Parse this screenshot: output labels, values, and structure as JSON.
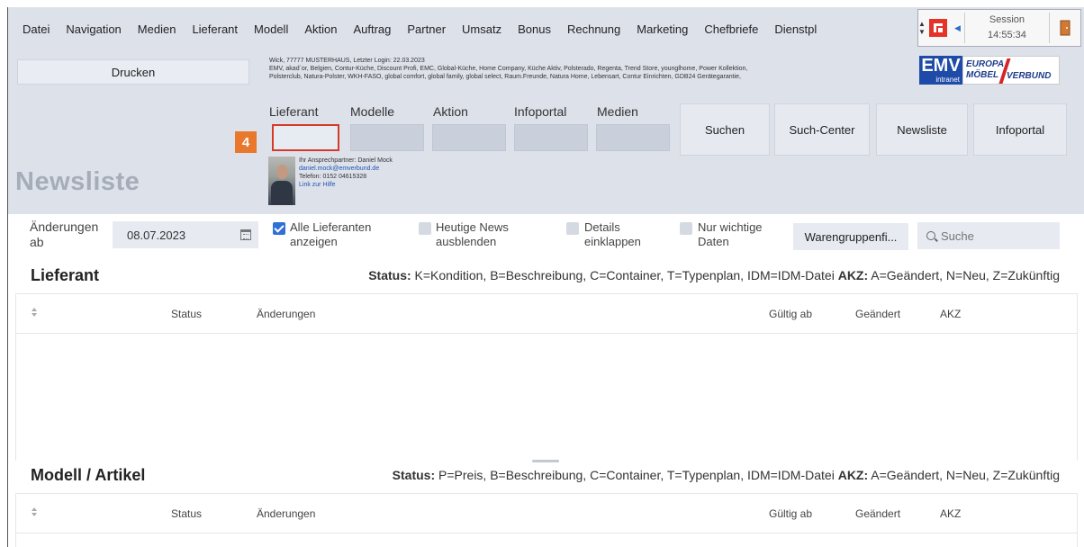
{
  "menu": [
    "Datei",
    "Navigation",
    "Medien",
    "Lieferant",
    "Modell",
    "Aktion",
    "Auftrag",
    "Partner",
    "Umsatz",
    "Bonus",
    "Rechnung",
    "Marketing",
    "Chefbriefe",
    "Dienstpl"
  ],
  "session": {
    "label": "Session",
    "time": "14:55:34"
  },
  "print_label": "Drucken",
  "info": {
    "line1": "Wick, 77777 MUSTERHAUS, Letzter Login: 22.03.2023",
    "line2": "EMV, akad`or, Belgien, Contur-Küche, Discount Profi, EMC, Global-Küche, Home Company, Küche Aktiv, Polsterado, Regenta, Trend Store, younglhome, Power Kollektion,",
    "line3": "Polsterclub, Natura-Polster, WKH-FASO, global comfort, global family, global select, Raum.Freunde, Natura Home, Lebensart, Contur Einrichten, GDB24 Gerätegarantie,"
  },
  "logos": {
    "emv": "EMV",
    "emv_sub": "intranet",
    "europa_1": "EUROPA",
    "europa_2": "MÖBEL",
    "europa_3": "VERBUND"
  },
  "filters": {
    "lieferant": "Lieferant",
    "modelle": "Modelle",
    "aktion": "Aktion",
    "infoportal": "Infoportal",
    "medien": "Medien"
  },
  "step_badge": "4",
  "buttons": {
    "suchen": "Suchen",
    "such_center": "Such-Center",
    "newsliste": "Newsliste",
    "infoportal": "Infoportal"
  },
  "contact": {
    "partner": "Ihr Ansprechpartner:   Daniel Mock",
    "email": "daniel.mock@emverbund.de",
    "phone": "Telefon:   0152 04615328",
    "help": "Link zur Hilfe"
  },
  "page_title": "Newsliste",
  "options": {
    "changes_label_1": "Änderungen",
    "changes_label_2": "ab",
    "date": "08.07.2023",
    "all_suppliers_1": "Alle Lieferanten",
    "all_suppliers_2": "anzeigen",
    "all_suppliers_checked": true,
    "today_news_1": "Heutige News",
    "today_news_2": "ausblenden",
    "details_1": "Details",
    "details_2": "einklappen",
    "important_1": "Nur wichtige",
    "important_2": "Daten",
    "warengruppen": "Warengruppenfi...",
    "search_placeholder": "Suche"
  },
  "sections": {
    "lieferant": {
      "title": "Lieferant",
      "status_key": "Status:",
      "status_text": "K=Kondition, B=Beschreibung, C=Container, T=Typenplan, IDM=IDM-Datei",
      "akz_key": "AKZ:",
      "akz_text": "A=Geändert, N=Neu, Z=Zukünftig"
    },
    "modell": {
      "title": "Modell / Artikel",
      "status_key": "Status:",
      "status_text": "P=Preis, B=Beschreibung, C=Container, T=Typenplan, IDM=IDM-Datei",
      "akz_key": "AKZ:",
      "akz_text": "A=Geändert, N=Neu, Z=Zukünftig"
    }
  },
  "columns": {
    "status": "Status",
    "aenderungen": "Änderungen",
    "gueltig_ab": "Gültig ab",
    "geaendert": "Geändert",
    "akz": "AKZ"
  }
}
